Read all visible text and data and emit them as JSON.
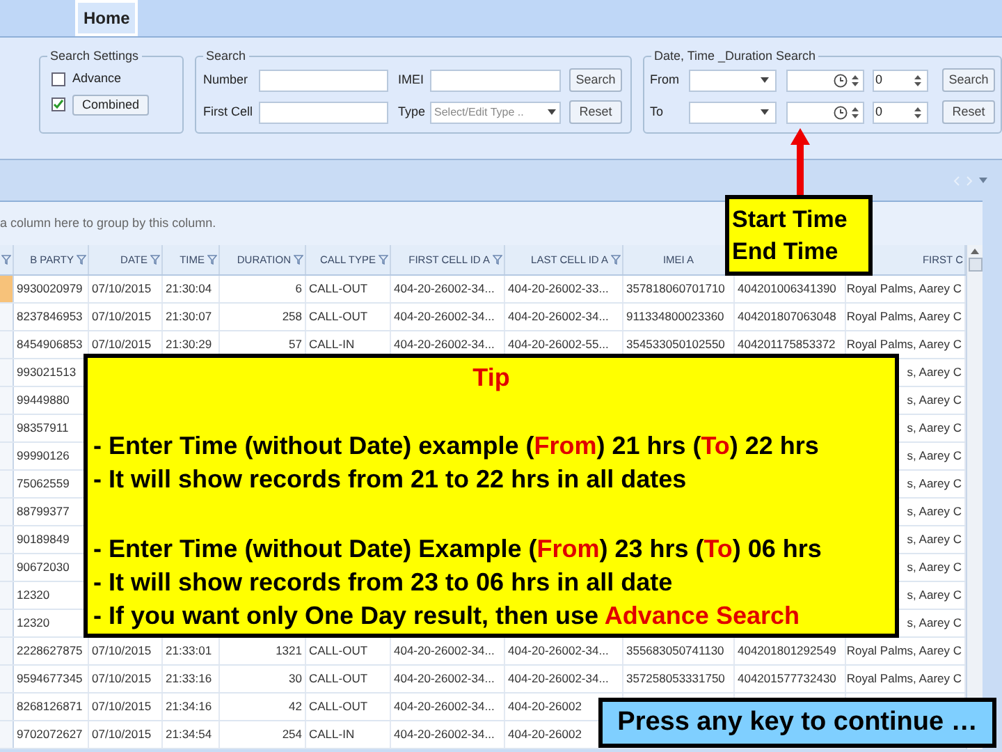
{
  "tabs": [
    {
      "label": "Home",
      "selected": true
    }
  ],
  "search_settings": {
    "title": "Search Settings",
    "options": [
      {
        "label": "Advance",
        "checked": false,
        "kind": "plain"
      },
      {
        "label": "Combined",
        "checked": true,
        "kind": "button"
      }
    ]
  },
  "search": {
    "title": "Search",
    "rows": [
      {
        "label": "Number",
        "field2_label": "IMEI",
        "button": "Search"
      },
      {
        "label": "First Cell",
        "field2_label": "Type",
        "field2_placeholder": "Select/Edit Type ..",
        "button": "Reset"
      }
    ]
  },
  "date_search": {
    "title": "Date, Time _Duration Search",
    "rows": [
      {
        "label": "From",
        "number": "0",
        "button": "Search"
      },
      {
        "label": "To",
        "number": "0",
        "button": "Reset"
      }
    ]
  },
  "group_panel": "a column here to group by this column.",
  "table": {
    "columns": [
      {
        "filterable": true
      },
      {
        "label": "B PARTY",
        "filterable": true
      },
      {
        "label": "DATE",
        "filterable": true
      },
      {
        "label": "TIME",
        "filterable": true
      },
      {
        "label": "DURATION",
        "filterable": true
      },
      {
        "label": "CALL TYPE",
        "filterable": true
      },
      {
        "label": "FIRST CELL ID A",
        "filterable": true
      },
      {
        "label": "LAST CELL ID A",
        "filterable": true
      },
      {
        "label": "IMEI A",
        "filterable": false
      },
      {},
      {
        "label": "FIRST C",
        "filterable": false
      }
    ],
    "rows": [
      {
        "selected": true,
        "cells": [
          null,
          "9930020979",
          "07/10/2015",
          "21:30:04",
          "6",
          "CALL-OUT",
          "404-20-26002-34...",
          "404-20-26002-33...",
          "357818060701710",
          "404201006341390",
          "Royal Palms, Aarey C"
        ]
      },
      {
        "selected": false,
        "cells": [
          null,
          "8237846953",
          "07/10/2015",
          "21:30:07",
          "258",
          "CALL-OUT",
          "404-20-26002-34...",
          "404-20-26002-34...",
          "911334800023360",
          "404201807063048",
          "Royal Palms, Aarey C"
        ]
      },
      {
        "selected": false,
        "cells": [
          null,
          "8454906853",
          "07/10/2015",
          "21:30:29",
          "57",
          "CALL-IN",
          "404-20-26002-34...",
          "404-20-26002-55...",
          "354533050102550",
          "404201175853372",
          "Royal Palms, Aarey C"
        ]
      },
      {
        "selected": false,
        "cells": [
          null,
          "993021513",
          null,
          null,
          null,
          null,
          null,
          null,
          null,
          null,
          "s, Aarey C"
        ]
      },
      {
        "selected": false,
        "cells": [
          null,
          "99449880",
          null,
          null,
          null,
          null,
          null,
          null,
          null,
          null,
          "s, Aarey C"
        ]
      },
      {
        "selected": false,
        "cells": [
          null,
          "98357911",
          null,
          null,
          null,
          null,
          null,
          null,
          null,
          null,
          "s, Aarey C"
        ]
      },
      {
        "selected": false,
        "cells": [
          null,
          "99990126",
          null,
          null,
          null,
          null,
          null,
          null,
          null,
          null,
          "s, Aarey C"
        ]
      },
      {
        "selected": false,
        "cells": [
          null,
          "75062559",
          null,
          null,
          null,
          null,
          null,
          null,
          null,
          null,
          "s, Aarey C"
        ]
      },
      {
        "selected": false,
        "cells": [
          null,
          "88799377",
          null,
          null,
          null,
          null,
          null,
          null,
          null,
          null,
          "s, Aarey C"
        ]
      },
      {
        "selected": false,
        "cells": [
          null,
          "90189849",
          null,
          null,
          null,
          null,
          null,
          null,
          null,
          null,
          "s, Aarey C"
        ]
      },
      {
        "selected": false,
        "cells": [
          null,
          "90672030",
          null,
          null,
          null,
          null,
          null,
          null,
          null,
          null,
          "s, Aarey C"
        ]
      },
      {
        "selected": false,
        "cells": [
          null,
          "12320",
          null,
          null,
          null,
          null,
          null,
          null,
          null,
          null,
          "s, Aarey C"
        ]
      },
      {
        "selected": false,
        "cells": [
          null,
          "12320",
          null,
          null,
          null,
          null,
          null,
          null,
          null,
          null,
          "s, Aarey C"
        ]
      },
      {
        "selected": false,
        "cells": [
          null,
          "2228627875",
          "07/10/2015",
          "21:33:01",
          "1321",
          "CALL-OUT",
          "404-20-26002-34...",
          "404-20-26002-34...",
          "355683050741130",
          "404201801292549",
          "Royal Palms, Aarey C"
        ]
      },
      {
        "selected": false,
        "cells": [
          null,
          "9594677345",
          "07/10/2015",
          "21:33:16",
          "30",
          "CALL-OUT",
          "404-20-26002-34...",
          "404-20-26002-34...",
          "357258053331750",
          "404201577732430",
          "Royal Palms, Aarey C"
        ]
      },
      {
        "selected": false,
        "cells": [
          null,
          "8268126871",
          "07/10/2015",
          "21:34:16",
          "42",
          "CALL-OUT",
          "404-20-26002-34...",
          "404-20-26002",
          null,
          null,
          null
        ]
      },
      {
        "selected": false,
        "cells": [
          null,
          "9702072627",
          "07/10/2015",
          "21:34:54",
          "254",
          "CALL-IN",
          "404-20-26002-34...",
          "404-20-26002",
          null,
          null,
          null
        ]
      }
    ]
  },
  "callout": {
    "lines": [
      "Start Time",
      "End Time"
    ]
  },
  "tip": {
    "title": "Tip",
    "paragraphs": [
      [
        [
          {
            "text": "- Enter Time (without Date) example (",
            "highlight": false
          },
          {
            "text": "From",
            "highlight": true
          },
          {
            "text": ") 21 hrs (",
            "highlight": false
          },
          {
            "text": "To",
            "highlight": true
          },
          {
            "text": ") 22 hrs",
            "highlight": false
          }
        ],
        [
          {
            "text": "- It will show records from 21 to 22 hrs in all dates",
            "highlight": false
          }
        ]
      ],
      [
        [
          {
            "text": "- Enter Time (without Date) Example (",
            "highlight": false
          },
          {
            "text": "From",
            "highlight": true
          },
          {
            "text": ") 23 hrs (",
            "highlight": false
          },
          {
            "text": "To",
            "highlight": true
          },
          {
            "text": ") 06 hrs",
            "highlight": false
          }
        ],
        [
          {
            "text": "- It will show records from 23 to 06 hrs in all date",
            "highlight": false
          }
        ],
        [
          {
            "text": "- If you want only One Day result, then use ",
            "highlight": false
          },
          {
            "text": "Advance Search",
            "highlight": true
          }
        ]
      ]
    ]
  },
  "prompt": "Press any key to continue …"
}
